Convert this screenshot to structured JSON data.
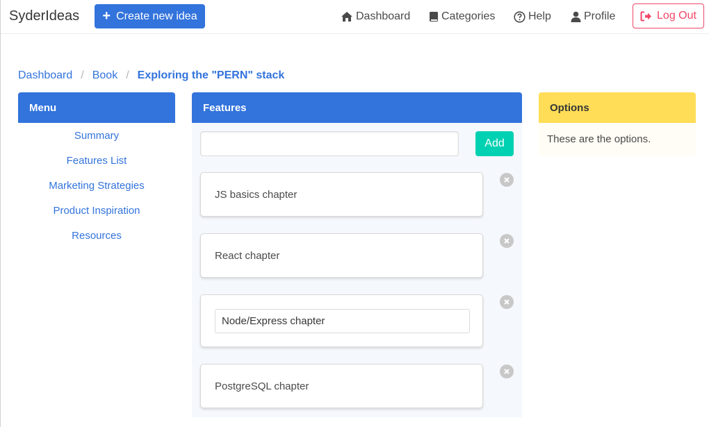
{
  "navbar": {
    "brand": "SyderIdeas",
    "create_label": "Create new idea",
    "items": [
      {
        "label": "Dashboard",
        "icon": "home-icon"
      },
      {
        "label": "Categories",
        "icon": "book-icon"
      },
      {
        "label": "Help",
        "icon": "help-circle-icon"
      },
      {
        "label": "Profile",
        "icon": "user-icon"
      }
    ],
    "logout_label": "Log Out"
  },
  "breadcrumb": [
    "Dashboard",
    "Book",
    "Exploring the \"PERN\" stack"
  ],
  "menu": {
    "title": "Menu",
    "items": [
      "Summary",
      "Features List",
      "Marketing Strategies",
      "Product Inspiration",
      "Resources"
    ]
  },
  "features": {
    "title": "Features",
    "input_value": "",
    "add_label": "Add",
    "items": [
      {
        "text": "JS basics chapter",
        "editing": false
      },
      {
        "text": "React chapter",
        "editing": false
      },
      {
        "text": "Node/Express chapter",
        "editing": true
      },
      {
        "text": "PostgreSQL chapter",
        "editing": false
      }
    ]
  },
  "options": {
    "title": "Options",
    "body": "These are the options."
  },
  "colors": {
    "primary": "#3273dc",
    "success": "#00d1b2",
    "warning": "#ffdd57",
    "danger": "#f14668"
  }
}
